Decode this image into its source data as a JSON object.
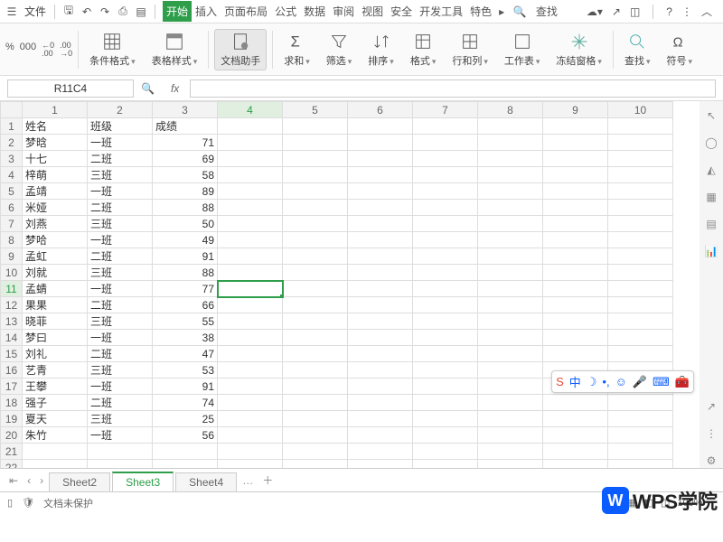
{
  "menubar": {
    "file_label": "文件"
  },
  "tabs": [
    "开始",
    "插入",
    "页面布局",
    "公式",
    "数据",
    "审阅",
    "视图",
    "安全",
    "开发工具",
    "特色"
  ],
  "search_label": "查找",
  "ribbon": {
    "cond_fmt": "条件格式",
    "tbl_style": "表格样式",
    "doc_helper": "文档助手",
    "sum": "求和",
    "filter": "筛选",
    "sort": "排序",
    "format": "格式",
    "rowcol": "行和列",
    "worksheet": "工作表",
    "freeze": "冻结窗格",
    "find": "查找",
    "symbol": "符号"
  },
  "small": {
    "pct": "%",
    "sep": "000",
    "dec_inc": "←0\n.00",
    "dec_dec": ".00\n→0"
  },
  "namebox": "R11C4",
  "fx_label": "fx",
  "columns": [
    "1",
    "2",
    "3",
    "4",
    "5",
    "6",
    "7",
    "8",
    "9",
    "10"
  ],
  "chart_data": {
    "type": "table",
    "title": "",
    "headers": [
      "姓名",
      "班级",
      "成绩"
    ],
    "rows": [
      [
        "梦晗",
        "一班",
        71
      ],
      [
        "十七",
        "二班",
        69
      ],
      [
        "梓萌",
        "三班",
        58
      ],
      [
        "孟靖",
        "一班",
        89
      ],
      [
        "米娅",
        "二班",
        88
      ],
      [
        "刘燕",
        "三班",
        50
      ],
      [
        "梦哈",
        "一班",
        49
      ],
      [
        "孟虹",
        "二班",
        91
      ],
      [
        "刘就",
        "三班",
        88
      ],
      [
        "孟蜻",
        "一班",
        77
      ],
      [
        "果果",
        "二班",
        66
      ],
      [
        "晓菲",
        "三班",
        55
      ],
      [
        "梦曰",
        "一班",
        38
      ],
      [
        "刘礼",
        "二班",
        47
      ],
      [
        "艺青",
        "三班",
        53
      ],
      [
        "王攀",
        "一班",
        91
      ],
      [
        "强子",
        "二班",
        74
      ],
      [
        "夏天",
        "三班",
        25
      ],
      [
        "朱竹",
        "一班",
        56
      ]
    ]
  },
  "sheet_tabs": [
    "Sheet2",
    "Sheet3",
    "Sheet4"
  ],
  "active_sheet": 1,
  "status": {
    "protect": "文档未保护",
    "zoom": "100%"
  },
  "watermark": "WPS学院",
  "floatbar": {
    "ch": "中"
  }
}
